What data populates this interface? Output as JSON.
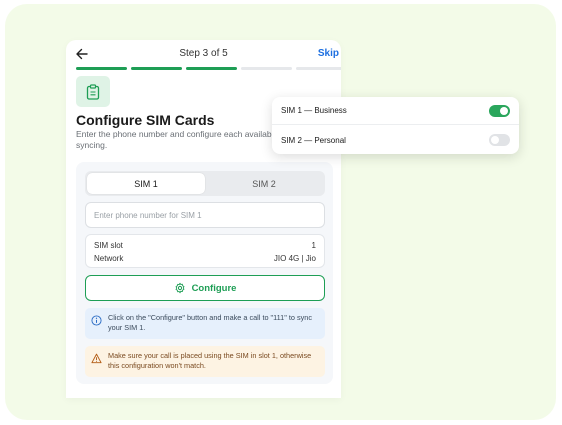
{
  "header": {
    "step_title": "Step 3 of 5",
    "skip_label": "Skip"
  },
  "progress": {
    "total_steps": 5,
    "completed_steps": 3,
    "active_color": "#1e9e55",
    "inactive_color": "#e6e8eb"
  },
  "page": {
    "title": "Configure SIM Cards",
    "description": "Enter the phone number and configure each available SIM for call syncing."
  },
  "tabs": [
    {
      "label": "SIM 1",
      "active": true
    },
    {
      "label": "SIM 2",
      "active": false
    }
  ],
  "phone_input": {
    "placeholder": "Enter phone number for SIM 1",
    "value": ""
  },
  "sim_info": {
    "rows": [
      {
        "label": "SIM slot",
        "value": "1"
      },
      {
        "label": "Network",
        "value": "JIO 4G | Jio"
      }
    ]
  },
  "configure_button": {
    "label": "Configure",
    "color": "#1e9e55"
  },
  "notes": {
    "info": "Click on the \"Configure\" button and make a call to \"111\" to sync your SIM 1.",
    "warning": "Make sure your call is placed using the SIM in slot 1, otherwise this configuration won't match."
  },
  "sim_popup": {
    "items": [
      {
        "label": "SIM 1 — Business",
        "enabled": true
      },
      {
        "label": "SIM 2 — Personal",
        "enabled": false
      }
    ]
  },
  "icons": {
    "back": "arrow-left-icon",
    "document": "clipboard-icon",
    "configure": "gear-icon",
    "info": "info-circle-icon",
    "warning": "warning-triangle-icon"
  }
}
